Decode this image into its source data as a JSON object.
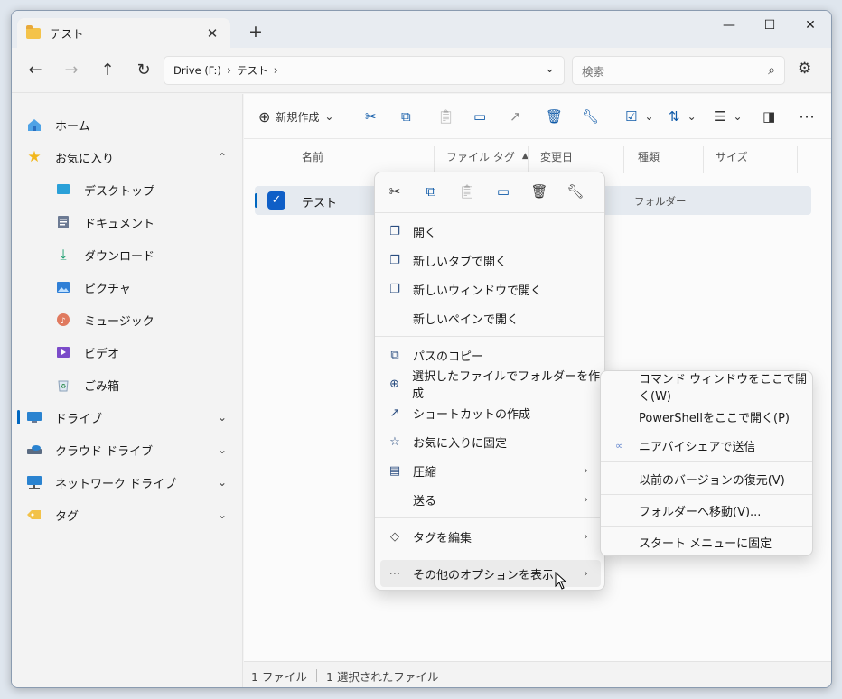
{
  "window": {
    "tab_title": "テスト",
    "tab_close": "✕",
    "new_tab": "+",
    "minimize": "—",
    "maximize": "☐",
    "close": "✕"
  },
  "nav": {
    "back": "←",
    "forward": "→",
    "up": "↑",
    "refresh": "↻",
    "breadcrumb": [
      "Drive (F:)",
      "テスト"
    ],
    "sep": "›",
    "dropdown": "⌄",
    "search_placeholder": "検索",
    "search_icon": "⌕",
    "settings_icon": "⚙"
  },
  "sidebar": {
    "items": [
      {
        "label": "ホーム",
        "icon": "home-icon",
        "level": "top"
      },
      {
        "label": "お気に入り",
        "icon": "star-icon",
        "level": "top",
        "caret": "⌃"
      },
      {
        "label": "デスクトップ",
        "icon": "desktop-icon",
        "level": "sub"
      },
      {
        "label": "ドキュメント",
        "icon": "document-icon",
        "level": "sub"
      },
      {
        "label": "ダウンロード",
        "icon": "download-icon",
        "level": "sub"
      },
      {
        "label": "ピクチャ",
        "icon": "picture-icon",
        "level": "sub"
      },
      {
        "label": "ミュージック",
        "icon": "music-icon",
        "level": "sub"
      },
      {
        "label": "ビデオ",
        "icon": "video-icon",
        "level": "sub"
      },
      {
        "label": "ごみ箱",
        "icon": "recycle-bin-icon",
        "level": "sub"
      },
      {
        "label": "ドライブ",
        "icon": "drive-icon",
        "level": "top",
        "caret": "⌄",
        "active": true
      },
      {
        "label": "クラウド ドライブ",
        "icon": "cloud-drive-icon",
        "level": "top",
        "caret": "⌄"
      },
      {
        "label": "ネットワーク ドライブ",
        "icon": "network-drive-icon",
        "level": "top",
        "caret": "⌄"
      },
      {
        "label": "タグ",
        "icon": "tag-icon",
        "level": "top",
        "caret": "⌄"
      }
    ]
  },
  "toolbar": {
    "new_label": "新規作成",
    "new_icon": "⊕",
    "chevron": "⌄",
    "more": "⋯"
  },
  "columns": [
    "名前",
    "ファイル タグ",
    "変更日",
    "種類",
    "サイズ"
  ],
  "sort_indicator": "▲",
  "file_row": {
    "name": "テスト",
    "type": "フォルダー",
    "check": "✓"
  },
  "context_menu": {
    "items": [
      {
        "label": "開く",
        "icon": "open-icon"
      },
      {
        "label": "新しいタブで開く",
        "icon": "open-tab-icon"
      },
      {
        "label": "新しいウィンドウで開く",
        "icon": "open-window-icon"
      },
      {
        "label": "新しいペインで開く",
        "icon": ""
      },
      {
        "label": "パスのコピー",
        "icon": "copy-path-icon"
      },
      {
        "label": "選択したファイルでフォルダーを作成",
        "icon": "new-folder-icon"
      },
      {
        "label": "ショートカットの作成",
        "icon": "shortcut-icon"
      },
      {
        "label": "お気に入りに固定",
        "icon": "pin-favorite-icon"
      },
      {
        "label": "圧縮",
        "icon": "compress-icon",
        "arrow": "›"
      },
      {
        "label": "送る",
        "icon": "",
        "arrow": "›"
      },
      {
        "label": "タグを編集",
        "icon": "tag-icon",
        "arrow": "›"
      },
      {
        "label": "その他のオプションを表示",
        "icon": "more-icon",
        "arrow": "›"
      }
    ]
  },
  "submenu": {
    "items": [
      {
        "label": "コマンド ウィンドウをここで開く(W)"
      },
      {
        "label": "PowerShellをここで開く(P)"
      },
      {
        "label": "ニアバイシェアで送信",
        "icon": "∞"
      },
      {
        "label": "以前のバージョンの復元(V)"
      },
      {
        "label": "フォルダーへ移動(V)..."
      },
      {
        "label": "スタート メニューに固定"
      }
    ]
  },
  "status": {
    "files": "1 ファイル",
    "selected": "1 選択されたファイル"
  },
  "colors": {
    "accent": "#0067c0",
    "folder": "#f4c34a"
  }
}
